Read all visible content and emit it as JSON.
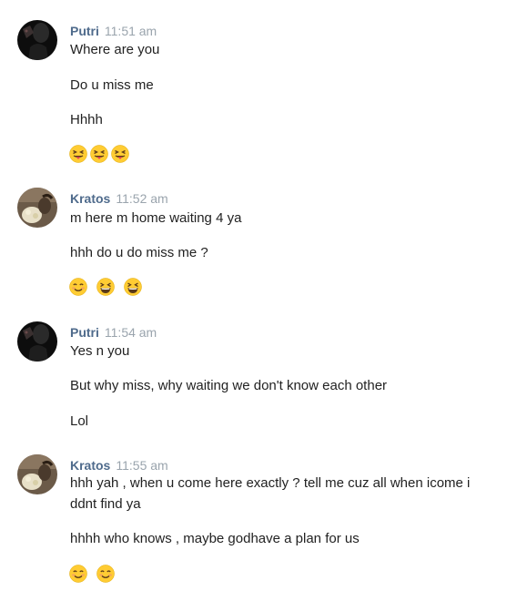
{
  "conversation": {
    "groups": [
      {
        "sender": "Putri",
        "time": "11:51 am",
        "lines": [
          "Where are you",
          "Do u miss me",
          "Hhhh"
        ],
        "emojis": [
          "squinting-tongue-emoji",
          "squinting-tongue-emoji",
          "squinting-tongue-emoji"
        ]
      },
      {
        "sender": "Kratos",
        "time": "11:52 am",
        "lines": [
          "m here m home waiting 4 ya",
          "hhh do u do miss me ?"
        ],
        "emojis": [
          "smiling-blush-emoji",
          "laughing-squint-emoji",
          "laughing-squint-emoji"
        ]
      },
      {
        "sender": "Putri",
        "time": "11:54 am",
        "lines": [
          "Yes n you",
          "But why miss, why waiting we don't know each other",
          "Lol"
        ],
        "emojis": []
      },
      {
        "sender": "Kratos",
        "time": "11:55 am",
        "lines": [
          "hhh yah , when u come here exactly ? tell me cuz all when icome i",
          "ddnt find ya",
          "hhhh who knows , maybe godhave a plan for us"
        ],
        "emojis": [
          "smiling-blush-emoji",
          "smiling-blush-emoji"
        ]
      }
    ]
  },
  "colors": {
    "sender_name": "#4f6b8c",
    "timestamp": "#9aa4ad",
    "message_text": "#222222",
    "emoji_face": "#ffcc33"
  }
}
